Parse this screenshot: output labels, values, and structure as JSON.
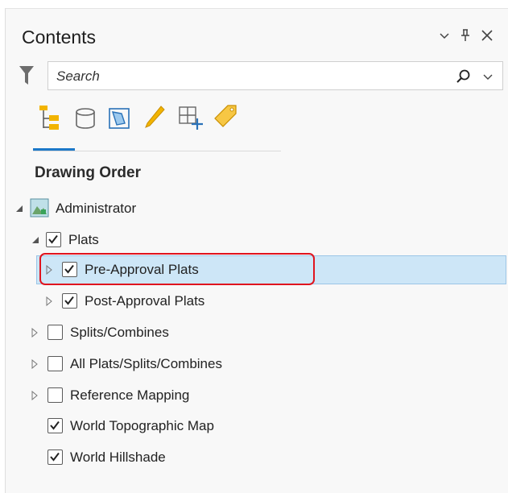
{
  "header": {
    "title": "Contents"
  },
  "search": {
    "placeholder": "Search",
    "value": ""
  },
  "toolbar": {
    "tools": [
      "list-by-drawing-order-icon",
      "list-by-data-source-icon",
      "list-by-selection-icon",
      "list-by-editing-icon",
      "list-by-snapping-icon",
      "list-by-labeling-icon"
    ]
  },
  "section": {
    "title": "Drawing Order"
  },
  "tree": {
    "map": "Administrator",
    "group": "Plats",
    "items": [
      {
        "label": "Pre-Approval Plats",
        "checked": true,
        "selected": true
      },
      {
        "label": "Post-Approval Plats",
        "checked": true
      },
      {
        "label": "Splits/Combines",
        "checked": false
      },
      {
        "label": "All Plats/Splits/Combines",
        "checked": false
      },
      {
        "label": "Reference Mapping",
        "checked": false
      },
      {
        "label": "World Topographic Map",
        "checked": true
      },
      {
        "label": "World Hillshade",
        "checked": true
      }
    ]
  },
  "colors": {
    "accent": "#1c78c8",
    "selection": "#cde6f7",
    "highlight": "#e0141e"
  }
}
